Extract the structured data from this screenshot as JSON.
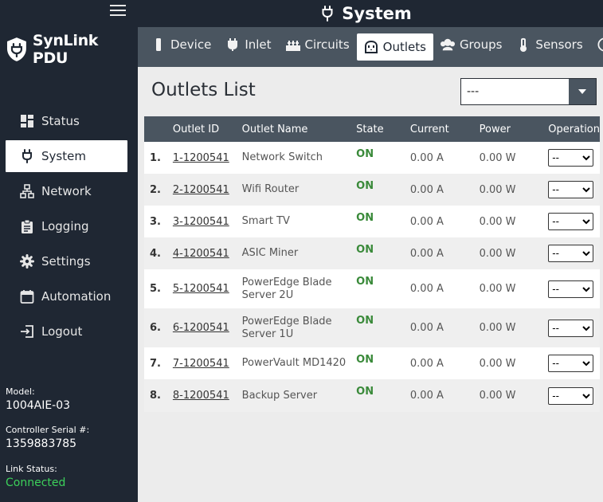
{
  "brand": {
    "name": "SynLink PDU",
    "icon": "shield-plug-icon"
  },
  "nav": [
    {
      "label": "Status",
      "icon": "dashboard-icon",
      "active": false
    },
    {
      "label": "System",
      "icon": "plug-icon",
      "active": true
    },
    {
      "label": "Network",
      "icon": "network-icon",
      "active": false
    },
    {
      "label": "Logging",
      "icon": "clipboard-icon",
      "active": false
    },
    {
      "label": "Settings",
      "icon": "gear-icon",
      "active": false
    },
    {
      "label": "Automation",
      "icon": "calendar-icon",
      "active": false
    },
    {
      "label": "Logout",
      "icon": "logout-icon",
      "active": false
    }
  ],
  "meta": {
    "model_label": "Model:",
    "model_value": "1004AIE-03",
    "serial_label": "Controller Serial #:",
    "serial_value": "1359883785",
    "link_label": "Link Status:",
    "link_value": "Connected",
    "link_color": "#3cd05a"
  },
  "header": {
    "title": "System",
    "icon": "plug-icon"
  },
  "tabs": [
    {
      "label": "Device",
      "icon": "device-icon",
      "active": false
    },
    {
      "label": "Inlet",
      "icon": "plug-icon",
      "active": false
    },
    {
      "label": "Circuits",
      "icon": "circuits-icon",
      "active": false
    },
    {
      "label": "Outlets",
      "icon": "outlet-icon",
      "active": true
    },
    {
      "label": "Groups",
      "icon": "groups-icon",
      "active": false
    },
    {
      "label": "Sensors",
      "icon": "thermometer-icon",
      "active": false
    },
    {
      "label": "",
      "icon": "clock-icon",
      "active": false
    }
  ],
  "main": {
    "title": "Outlets List",
    "filter_value": "---",
    "columns": [
      "",
      "Outlet ID",
      "Outlet Name",
      "State",
      "Current",
      "Power",
      "Operation"
    ],
    "rows": [
      {
        "num": "1.",
        "id": "1-1200541",
        "name": "Network Switch",
        "state": "ON",
        "current": "0.00 A",
        "power": "0.00 W",
        "operation": "--"
      },
      {
        "num": "2.",
        "id": "2-1200541",
        "name": "Wifi Router",
        "state": "ON",
        "current": "0.00 A",
        "power": "0.00 W",
        "operation": "--"
      },
      {
        "num": "3.",
        "id": "3-1200541",
        "name": "Smart TV",
        "state": "ON",
        "current": "0.00 A",
        "power": "0.00 W",
        "operation": "--"
      },
      {
        "num": "4.",
        "id": "4-1200541",
        "name": "ASIC Miner",
        "state": "ON",
        "current": "0.00 A",
        "power": "0.00 W",
        "operation": "--"
      },
      {
        "num": "5.",
        "id": "5-1200541",
        "name": "PowerEdge Blade Server 2U",
        "state": "ON",
        "current": "0.00 A",
        "power": "0.00 W",
        "operation": "--"
      },
      {
        "num": "6.",
        "id": "6-1200541",
        "name": "PowerEdge Blade Server 1U",
        "state": "ON",
        "current": "0.00 A",
        "power": "0.00 W",
        "operation": "--"
      },
      {
        "num": "7.",
        "id": "7-1200541",
        "name": "PowerVault MD1420",
        "state": "ON",
        "current": "0.00 A",
        "power": "0.00 W",
        "operation": "--"
      },
      {
        "num": "8.",
        "id": "8-1200541",
        "name": "Backup Server",
        "state": "ON",
        "current": "0.00 A",
        "power": "0.00 W",
        "operation": "--"
      }
    ]
  }
}
